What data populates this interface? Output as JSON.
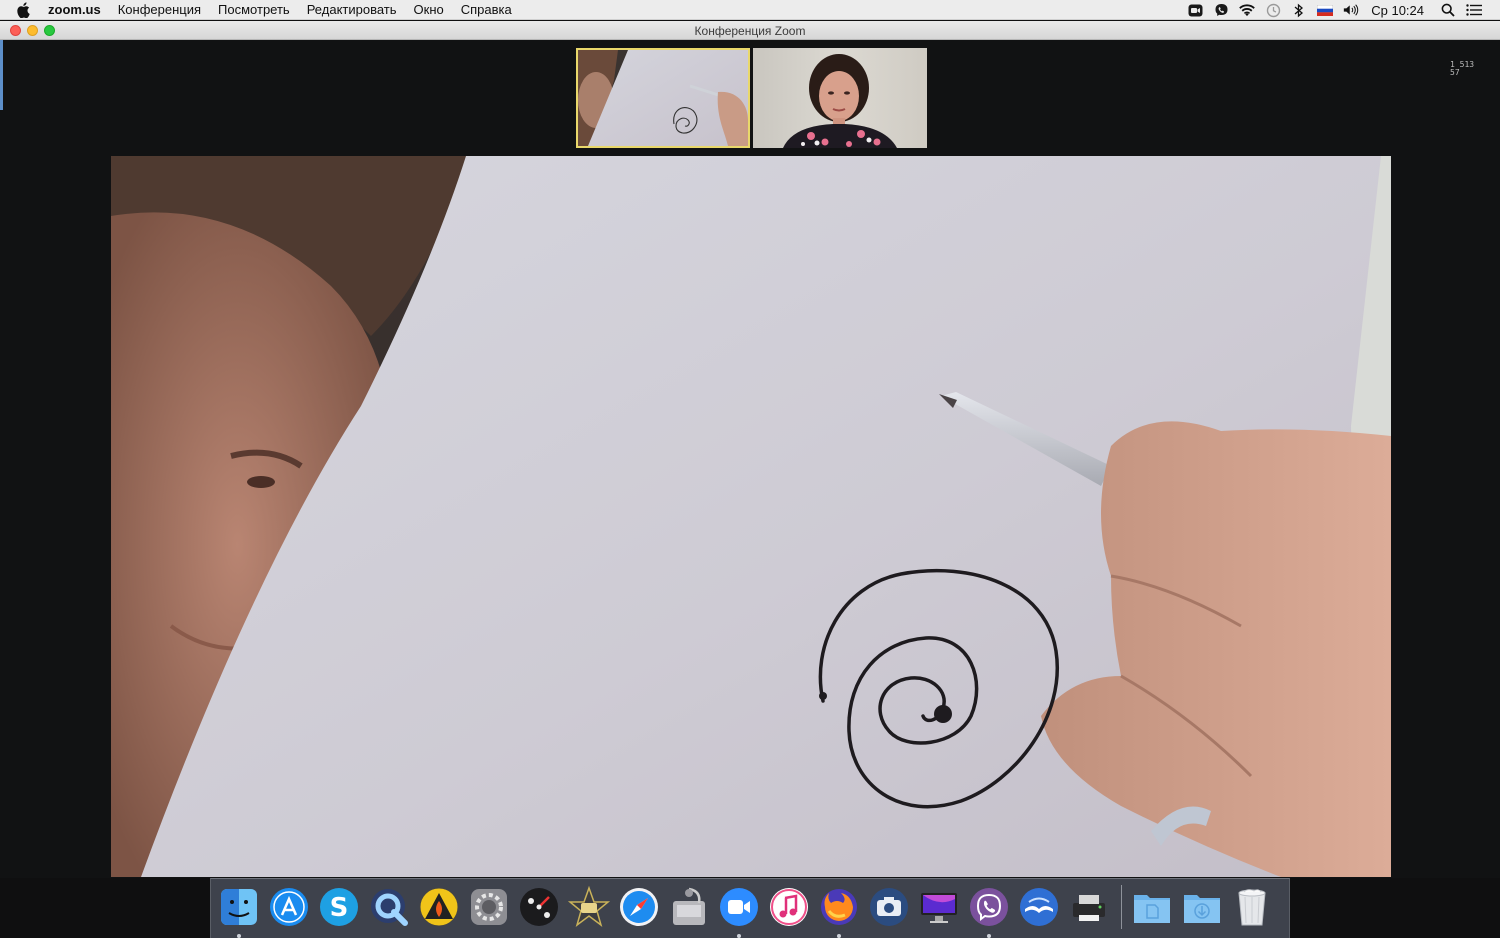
{
  "menubar": {
    "app_name": "zoom.us",
    "menus": [
      "Конференция",
      "Посмотреть",
      "Редактировать",
      "Окно",
      "Справка"
    ],
    "status_icons": [
      "zoom-status-icon",
      "viber-status-icon",
      "wifi-icon",
      "time-machine-icon",
      "bluetooth-icon",
      "russian-flag-icon",
      "volume-icon"
    ],
    "clock": "Ср 10:24",
    "right_icons": [
      "spotlight-search-icon",
      "notification-center-icon"
    ]
  },
  "window": {
    "title": "Конференция Zoom"
  },
  "video": {
    "stats_overlay": "1 513\n57",
    "thumbnails": [
      {
        "name": "participant-self-drawing",
        "active_speaker": true
      },
      {
        "name": "participant-woman",
        "active_speaker": false
      }
    ]
  },
  "dock": {
    "apps": [
      {
        "name": "finder",
        "running": true
      },
      {
        "name": "app-store",
        "running": false
      },
      {
        "name": "skype",
        "running": false
      },
      {
        "name": "quicktime",
        "running": false
      },
      {
        "name": "burn",
        "running": false
      },
      {
        "name": "system-preferences",
        "running": false
      },
      {
        "name": "launchpad-dashboard",
        "running": false
      },
      {
        "name": "imovie",
        "running": false
      },
      {
        "name": "safari",
        "running": false
      },
      {
        "name": "disk-utility",
        "running": false
      },
      {
        "name": "zoom",
        "running": true
      },
      {
        "name": "itunes",
        "running": false
      },
      {
        "name": "firefox",
        "running": true
      },
      {
        "name": "image-capture",
        "running": false
      },
      {
        "name": "display",
        "running": false
      },
      {
        "name": "viber",
        "running": true
      },
      {
        "name": "migration-assistant",
        "running": false
      },
      {
        "name": "printer",
        "running": false
      }
    ],
    "stacks": [
      "documents-folder",
      "downloads-folder",
      "trash"
    ],
    "colors": {
      "running_indicator": "#cfd3d9"
    }
  }
}
